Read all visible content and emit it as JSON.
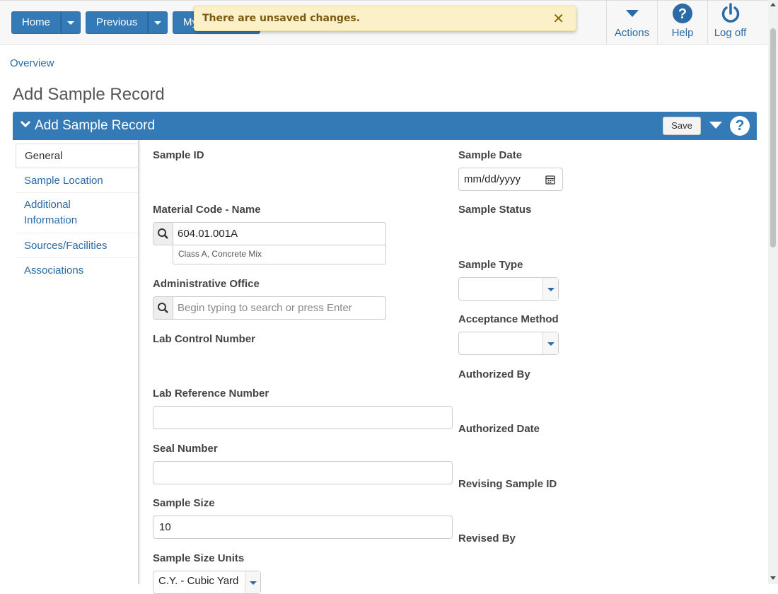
{
  "topbar": {
    "home_label": "Home",
    "previous_label": "Previous",
    "my_label": "My",
    "actions_label": "Actions",
    "help_label": "Help",
    "logoff_label": "Log off"
  },
  "toast": {
    "message": "There are unsaved changes.",
    "close_glyph": "✕"
  },
  "breadcrumb": "Overview",
  "page_title": "Add Sample Record",
  "panel": {
    "title": "Add Sample Record",
    "save_label": "Save",
    "help_glyph": "?"
  },
  "sidenav": {
    "items": [
      {
        "label": "General"
      },
      {
        "label": "Sample Location"
      },
      {
        "label": "Additional Information"
      },
      {
        "label": "Sources/Facilities"
      },
      {
        "label": "Associations"
      }
    ]
  },
  "form": {
    "sample_id_label": "Sample ID",
    "material_label": "Material Code - Name",
    "material_value": "604.01.001A",
    "material_desc": "Class A, Concrete Mix",
    "admin_office_label": "Administrative Office",
    "admin_office_placeholder": "Begin typing to search or press Enter",
    "lab_control_label": "Lab Control Number",
    "lab_ref_label": "Lab Reference Number",
    "lab_ref_value": "",
    "seal_label": "Seal Number",
    "seal_value": "",
    "sample_size_label": "Sample Size",
    "sample_size_value": "10",
    "size_units_label": "Sample Size Units",
    "size_units_value": "C.Y. - Cubic Yard",
    "sample_date_label": "Sample Date",
    "sample_date_placeholder": "mm/dd/yyyy",
    "sample_status_label": "Sample Status",
    "sample_type_label": "Sample Type",
    "sample_type_value": "",
    "acceptance_label": "Acceptance Method",
    "acceptance_value": "",
    "authorized_by_label": "Authorized By",
    "authorized_date_label": "Authorized Date",
    "revising_id_label": "Revising Sample ID",
    "revised_by_label": "Revised By"
  },
  "colors": {
    "primary": "#337ab7",
    "link": "#2a6aa6",
    "toast_bg": "#fcf0c8"
  }
}
